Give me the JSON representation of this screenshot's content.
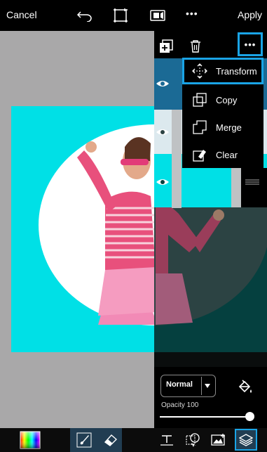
{
  "toolbar": {
    "cancel_label": "Cancel",
    "apply_label": "Apply",
    "more_label": "•••"
  },
  "layers_panel": {
    "more_label": "•••"
  },
  "menu": {
    "items": [
      {
        "label": "Transform",
        "icon": "transform-icon",
        "selected": true
      },
      {
        "label": "Copy",
        "icon": "copy-icon",
        "selected": false
      },
      {
        "label": "Merge",
        "icon": "merge-icon",
        "selected": false
      },
      {
        "label": "Clear",
        "icon": "clear-icon",
        "selected": false
      }
    ]
  },
  "layer_controls": {
    "blend_mode": "Normal",
    "opacity_label": "Opacity 100",
    "opacity": 100
  },
  "colors": {
    "accent": "#1aa4e6",
    "cyan": "#00e0e6",
    "dark_teal": "#05403f",
    "canvas_gray": "#a9a8a9"
  }
}
